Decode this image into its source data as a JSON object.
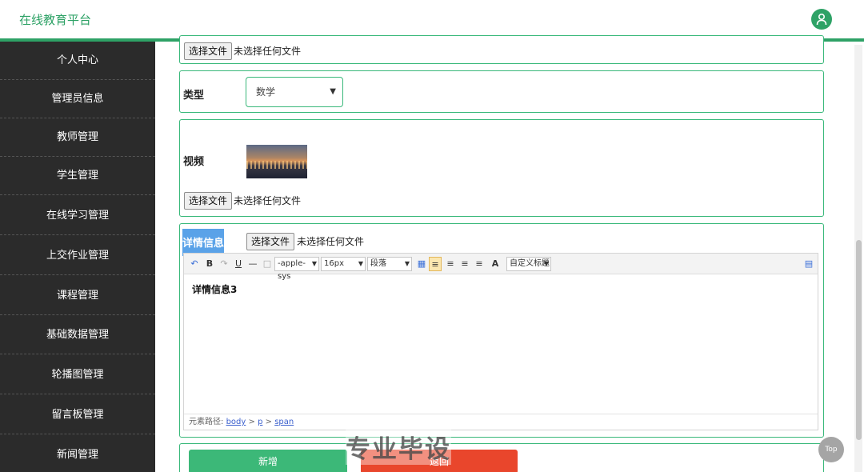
{
  "header": {
    "title": "在线教育平台"
  },
  "sidebar": {
    "items": [
      {
        "label": "个人中心"
      },
      {
        "label": "管理员信息"
      },
      {
        "label": "教师管理"
      },
      {
        "label": "学生管理"
      },
      {
        "label": "在线学习管理"
      },
      {
        "label": "上交作业管理"
      },
      {
        "label": "课程管理"
      },
      {
        "label": "基础数据管理"
      },
      {
        "label": "轮播图管理"
      },
      {
        "label": "留言板管理"
      },
      {
        "label": "新闻管理"
      }
    ]
  },
  "form": {
    "file_button": "选择文件",
    "no_file": "未选择任何文件",
    "type": {
      "label": "类型",
      "value": "数学"
    },
    "video": {
      "label": "视频"
    },
    "detail": {
      "label": "详情信息",
      "content": "详情信息3"
    },
    "toolbar": {
      "bold": "B",
      "underline": "U",
      "font_family": "-apple-sys",
      "font_size": "16px",
      "paragraph": "段落",
      "font_color": "A",
      "custom_title": "自定义标题"
    },
    "element_path": {
      "prefix": "元素路径:",
      "body": "body",
      "sep1": ">",
      "p": "p",
      "sep2": ">",
      "span": "span"
    }
  },
  "buttons": {
    "add": "新增",
    "back": "返回"
  },
  "watermark": "专业毕设",
  "top_button": "Top",
  "colors": {
    "accent": "#2ea266",
    "sidebar": "#2b2b2b",
    "add": "#3cb878",
    "back": "#e9462c"
  }
}
